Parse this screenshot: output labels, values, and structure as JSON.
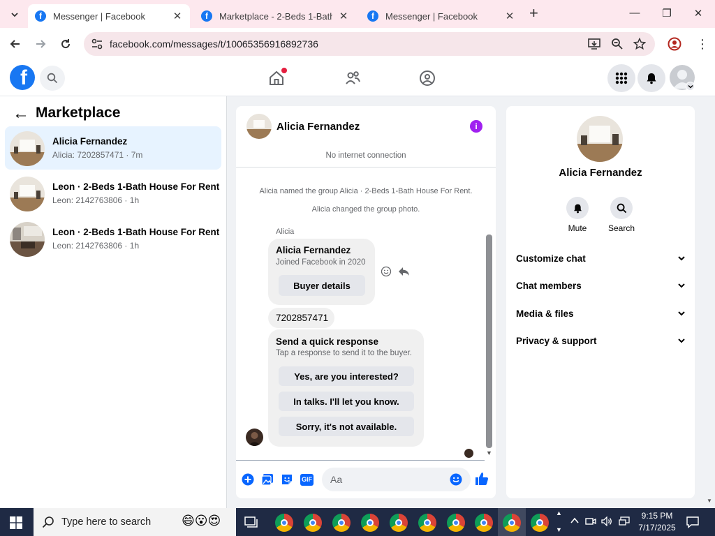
{
  "browser": {
    "tabs": [
      {
        "title": "Messenger | Facebook",
        "active": true
      },
      {
        "title": "Marketplace - 2-Beds 1-Bath Ho",
        "active": false
      },
      {
        "title": "Messenger | Facebook",
        "active": false
      }
    ],
    "new_tab": "+",
    "close": "✕",
    "url": "facebook.com/messages/t/10065356916892736"
  },
  "fb": {
    "logo": "f"
  },
  "left": {
    "back_arrow": "←",
    "heading": "Marketplace",
    "conversations": [
      {
        "name": "Alicia Fernandez",
        "sub": "Alicia: 7202857471 · 7m",
        "active": true
      },
      {
        "name": "Leon · 2-Beds 1-Bath House For Rent",
        "sub": "Leon: 2142763806 · 1h",
        "active": false
      },
      {
        "name": "Leon · 2-Beds 1-Bath House For Rent",
        "sub": "Leon: 2142763806 · 1h",
        "active": false
      }
    ]
  },
  "chat": {
    "header_name": "Alicia Fernandez",
    "status": "No internet connection",
    "system_messages": [
      "Alicia named the group Alicia · 2-Beds 1-Bath House For Rent.",
      "Alicia changed the group photo."
    ],
    "sender_label": "Alicia",
    "card": {
      "name": "Alicia Fernandez",
      "sub": "Joined Facebook in 2020",
      "button": "Buyer details"
    },
    "phone_message": "7202857471",
    "quick": {
      "title": "Send a quick response",
      "sub": "Tap a response to send it to the buyer.",
      "options": [
        "Yes, are you interested?",
        "In talks. I'll let you know.",
        "Sorry, it's not available."
      ]
    },
    "composer_placeholder": "Aa",
    "gif_label": "GIF"
  },
  "info": {
    "name": "Alicia Fernandez",
    "actions": [
      {
        "label": "Mute",
        "icon": "bell-icon"
      },
      {
        "label": "Search",
        "icon": "search-icon"
      }
    ],
    "sections": [
      "Customize chat",
      "Chat members",
      "Media & files",
      "Privacy & support"
    ]
  },
  "taskbar": {
    "search_placeholder": "Type here to search",
    "time": "9:15 PM",
    "date": "7/17/2025"
  },
  "colors": {
    "brand": "#1877f2",
    "messenger_purple": "#a020f0",
    "tab_strip": "#fde8ee",
    "active_conv": "#e7f3ff",
    "taskbar": "#1f2a44"
  }
}
